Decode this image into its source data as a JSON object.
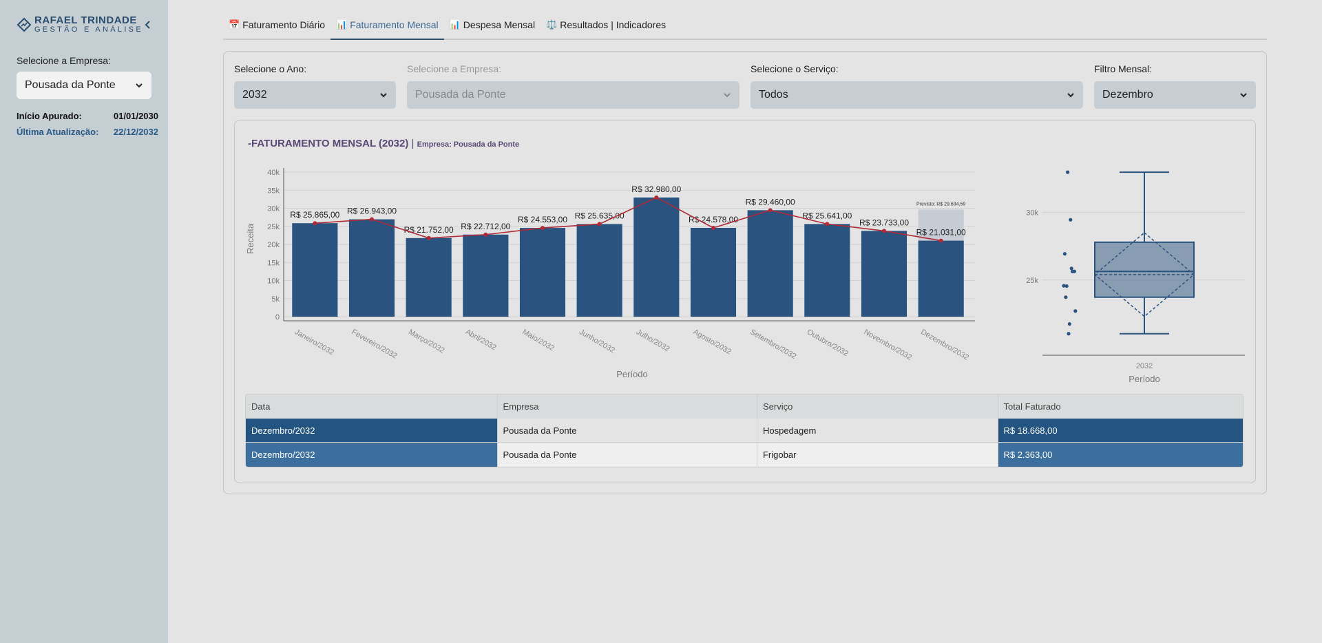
{
  "sidebar": {
    "logo_name": "RAFAEL TRINDADE",
    "logo_sub": "GESTÃO E ANÁLISE",
    "company_label": "Selecione a Empresa:",
    "company_value": "Pousada da Ponte",
    "inicio_label": "Início Apurado:",
    "inicio_value": "01/01/2030",
    "atualizacao_label": "Última Atualização:",
    "atualizacao_value": "22/12/2032"
  },
  "tabs": [
    {
      "icon": "📅",
      "label": "Faturamento Diário"
    },
    {
      "icon": "📊",
      "label": "Faturamento Mensal"
    },
    {
      "icon": "📊",
      "label": "Despesa Mensal"
    },
    {
      "icon": "⚖️",
      "label": "Resultados | Indicadores"
    }
  ],
  "active_tab": 1,
  "filters": {
    "ano": {
      "label": "Selecione o Ano:",
      "value": "2032"
    },
    "empresa": {
      "label": "Selecione a Empresa:",
      "value": "Pousada da Ponte"
    },
    "servico": {
      "label": "Selecione o Serviço:",
      "value": "Todos"
    },
    "mensal": {
      "label": "Filtro Mensal:",
      "value": "Dezembro"
    }
  },
  "chart_header": {
    "title": "-FATURAMENTO MENSAL (2032)",
    "separator": "|",
    "subtitle": "Empresa: Pousada da Ponte"
  },
  "colors": {
    "bar": "#2b5380",
    "bar_forecast": "#c7ccd4",
    "line": "#b02a37",
    "box": "#2b5380"
  },
  "chart_data": [
    {
      "type": "bar",
      "categories": [
        "Janeiro/2032",
        "Fevereiro/2032",
        "Março/2032",
        "Abril/2032",
        "Maio/2032",
        "Junho/2032",
        "Julho/2032",
        "Agosto/2032",
        "Setembro/2032",
        "Outubro/2032",
        "Novembro/2032",
        "Dezembro/2032"
      ],
      "values": [
        25865,
        26943,
        21752,
        22712,
        24553,
        25635,
        32980,
        24578,
        29460,
        25641,
        23733,
        21031
      ],
      "labels": [
        "R$ 25.865,00",
        "R$ 26.943,00",
        "R$ 21.752,00",
        "R$ 22.712,00",
        "R$ 24.553,00",
        "R$ 25.635,00",
        "R$ 32.980,00",
        "R$ 24.578,00",
        "R$ 29.460,00",
        "R$ 25.641,00",
        "R$ 23.733,00",
        "R$ 21.031,00"
      ],
      "forecast": {
        "category": "Dezembro/2032",
        "value": 29634.59,
        "label": "Previsto: R$ 29.634,59"
      },
      "line_overlay": true,
      "xlabel": "Período",
      "ylabel": "Receita",
      "ylim": [
        0,
        40000
      ],
      "yticks": [
        0,
        5000,
        10000,
        15000,
        20000,
        25000,
        30000,
        35000,
        40000
      ],
      "ytick_labels": [
        "0",
        "5k",
        "10k",
        "15k",
        "20k",
        "25k",
        "30k",
        "35k",
        "40k"
      ],
      "grid": true
    },
    {
      "type": "box",
      "categories": [
        "2032"
      ],
      "points": [
        25865,
        26943,
        21752,
        22712,
        24553,
        25635,
        32980,
        24578,
        29460,
        25641,
        23733,
        21031
      ],
      "stats": {
        "min": 21031,
        "q1": 23733,
        "median": 25638,
        "mean": 25407,
        "q3": 27800,
        "max": 32980,
        "sd": 3100
      },
      "xlabel": "Período",
      "ylim": [
        20000,
        33800
      ],
      "yticks": [
        25000,
        30000
      ],
      "ytick_labels": [
        "25k",
        "30k"
      ],
      "grid": true
    }
  ],
  "table": {
    "headers": [
      "Data",
      "Empresa",
      "Serviço",
      "Total Faturado"
    ],
    "rows": [
      [
        "Dezembro/2032",
        "Pousada da Ponte",
        "Hospedagem",
        "R$ 18.668,00"
      ],
      [
        "Dezembro/2032",
        "Pousada da Ponte",
        "Frigobar",
        "R$ 2.363,00"
      ]
    ]
  }
}
